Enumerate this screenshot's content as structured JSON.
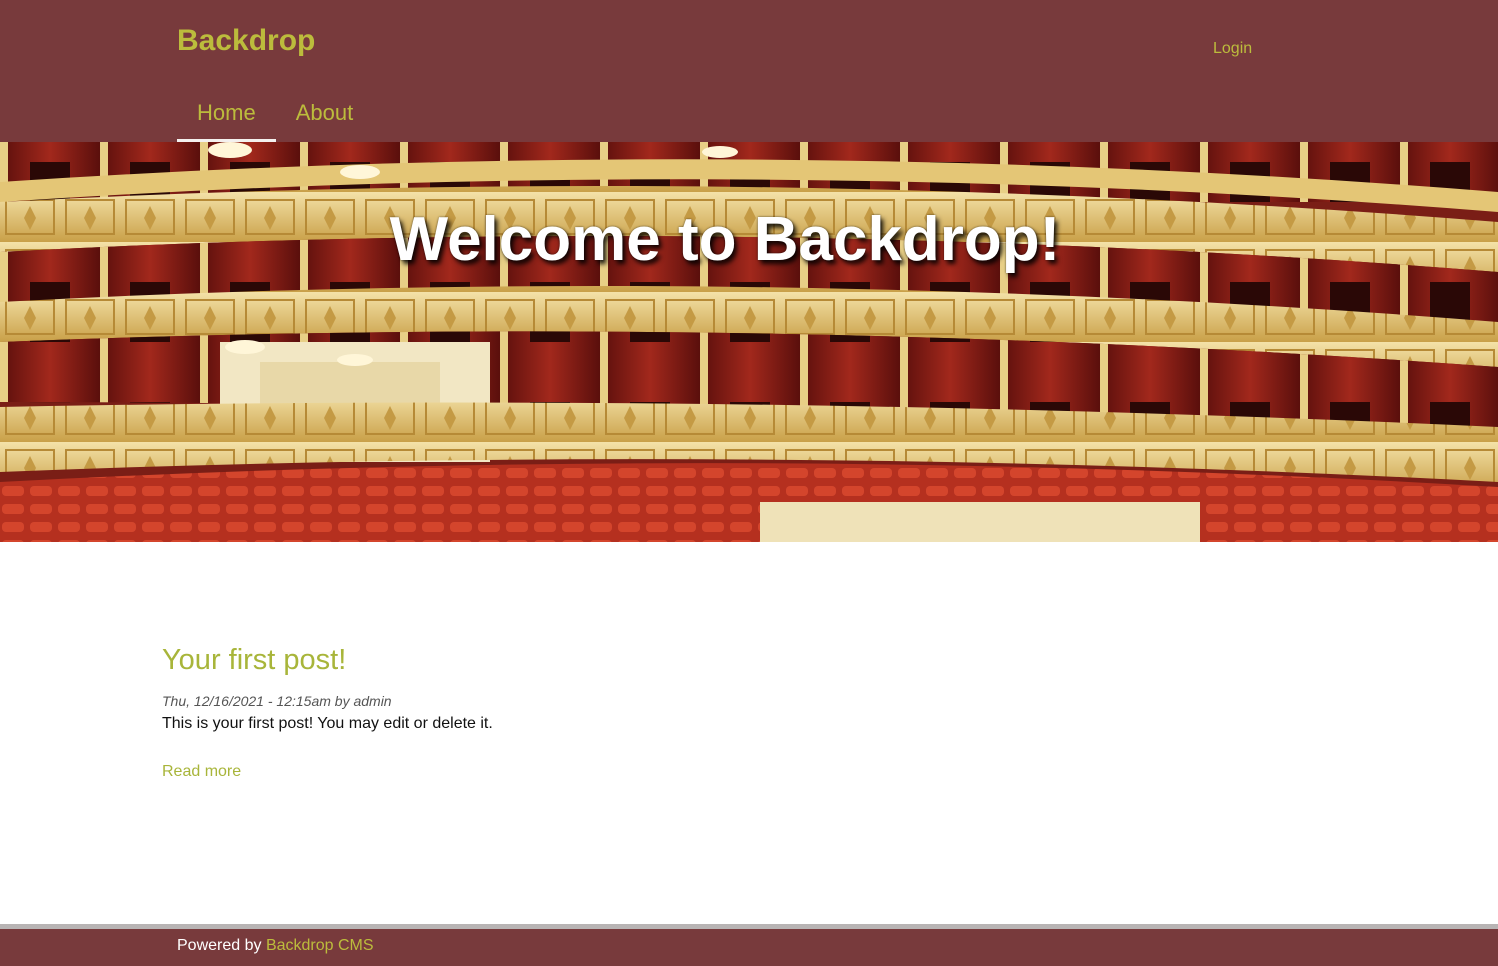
{
  "header": {
    "site_name": "Backdrop",
    "login_label": "Login",
    "menu": [
      {
        "label": "Home",
        "active": true
      },
      {
        "label": "About",
        "active": false
      }
    ]
  },
  "hero": {
    "title": "Welcome to Backdrop!"
  },
  "article": {
    "title": "Your first post!",
    "meta": "Thu, 12/16/2021 - 12:15am by admin",
    "body": "This is your first post! You may edit or delete it.",
    "read_more": "Read more"
  },
  "footer": {
    "prefix": "Powered by ",
    "link_label": "Backdrop CMS"
  },
  "colors": {
    "header_bg": "#783a3c",
    "accent": "#bcbc3c",
    "link": "#a8b53a"
  }
}
